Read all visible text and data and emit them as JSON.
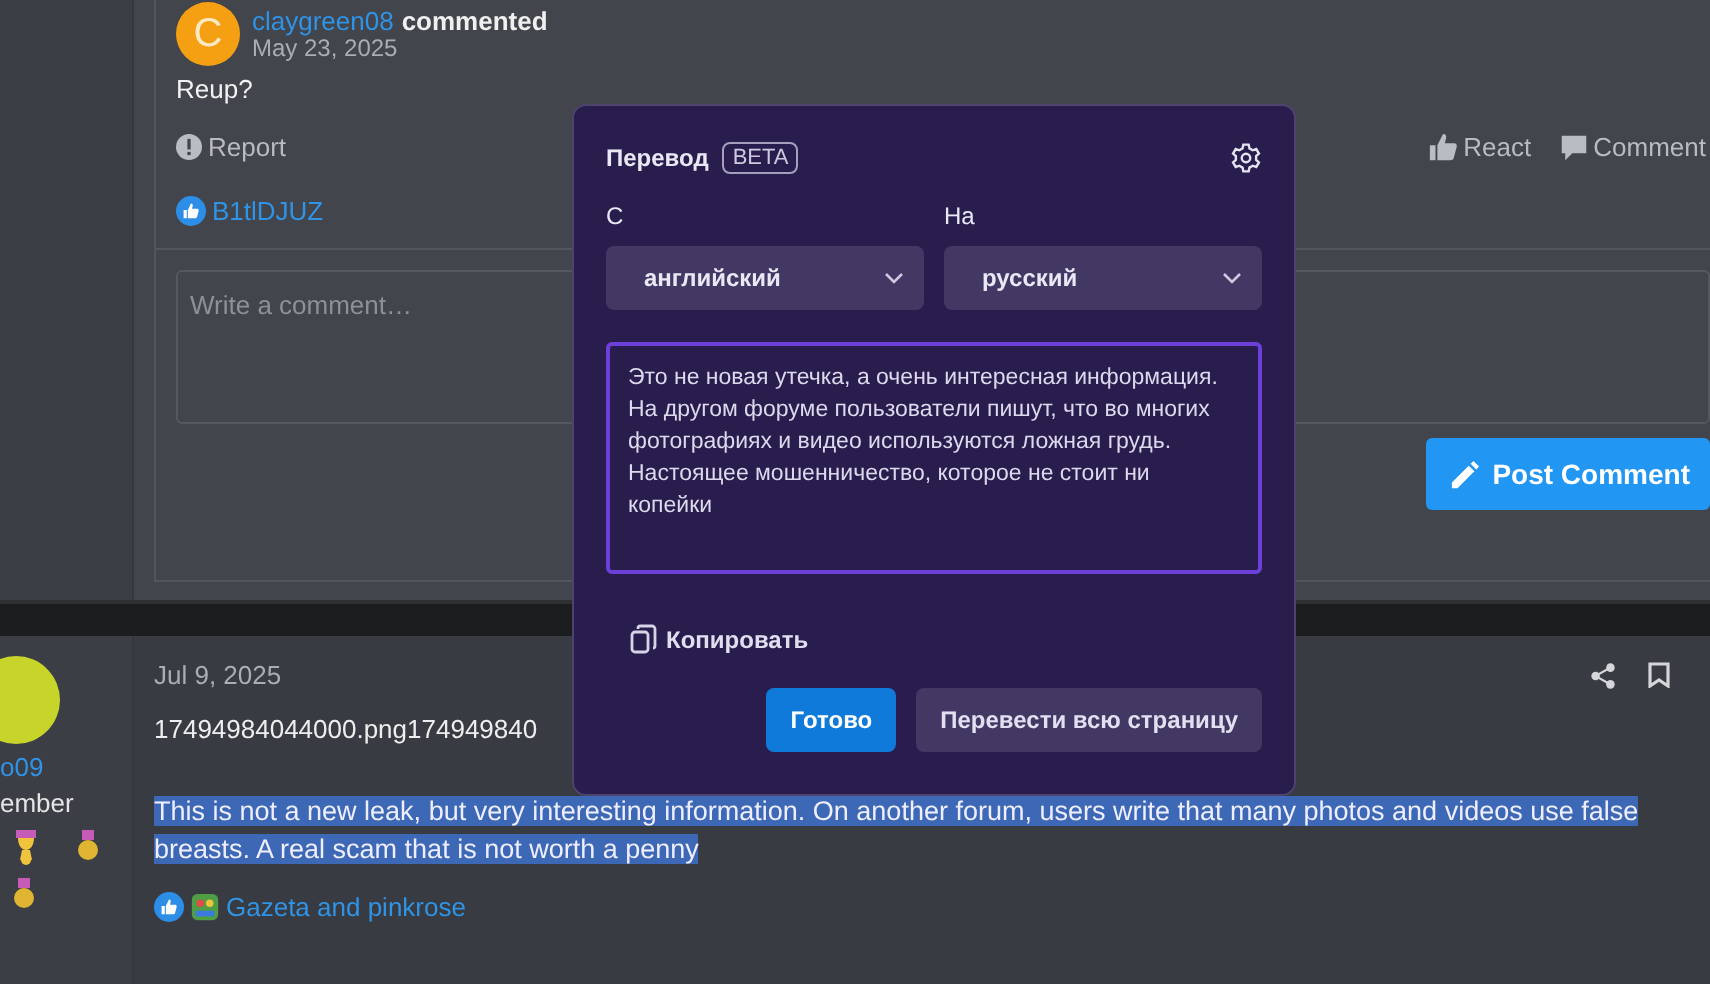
{
  "comment": {
    "author": "claygreen08",
    "action": "commented",
    "avatar_letter": "C",
    "date": "May 23, 2025",
    "body": "Reup?",
    "report": "Report",
    "actions": [
      "React",
      "Comment"
    ],
    "reactions": "B1tlDJUZ",
    "comment_field": {
      "placeholder": "Write a comment…"
    },
    "post_button": "Post Comment"
  },
  "post": {
    "user": {
      "name": "o09",
      "role": "ember"
    },
    "date": "Jul 9, 2025",
    "attachment": "17494984044000.png174949840",
    "body": "This is not a new leak, but very interesting information. On another forum, users write that many photos and videos use false breasts. A real scam that is not worth a penny",
    "reactions": "Gazeta and pinkrose"
  },
  "translate_popup": {
    "title": "Перевод",
    "badge": "BETA",
    "from_label": "С",
    "from_value": "английский",
    "to_label": "На",
    "to_value": "русский",
    "translation": "Это не новая утечка, а очень интересная информация. На другом форуме пользователи пишут, что во многих фотографиях и видео используются ложная грудь. Настоящее мошенничество, которое не стоит ни копейки",
    "copy": "Копировать",
    "buttons": [
      {
        "label": "Готово",
        "kind": "primary"
      },
      {
        "label": "Перевести всю страницу",
        "kind": "secondary"
      }
    ]
  }
}
